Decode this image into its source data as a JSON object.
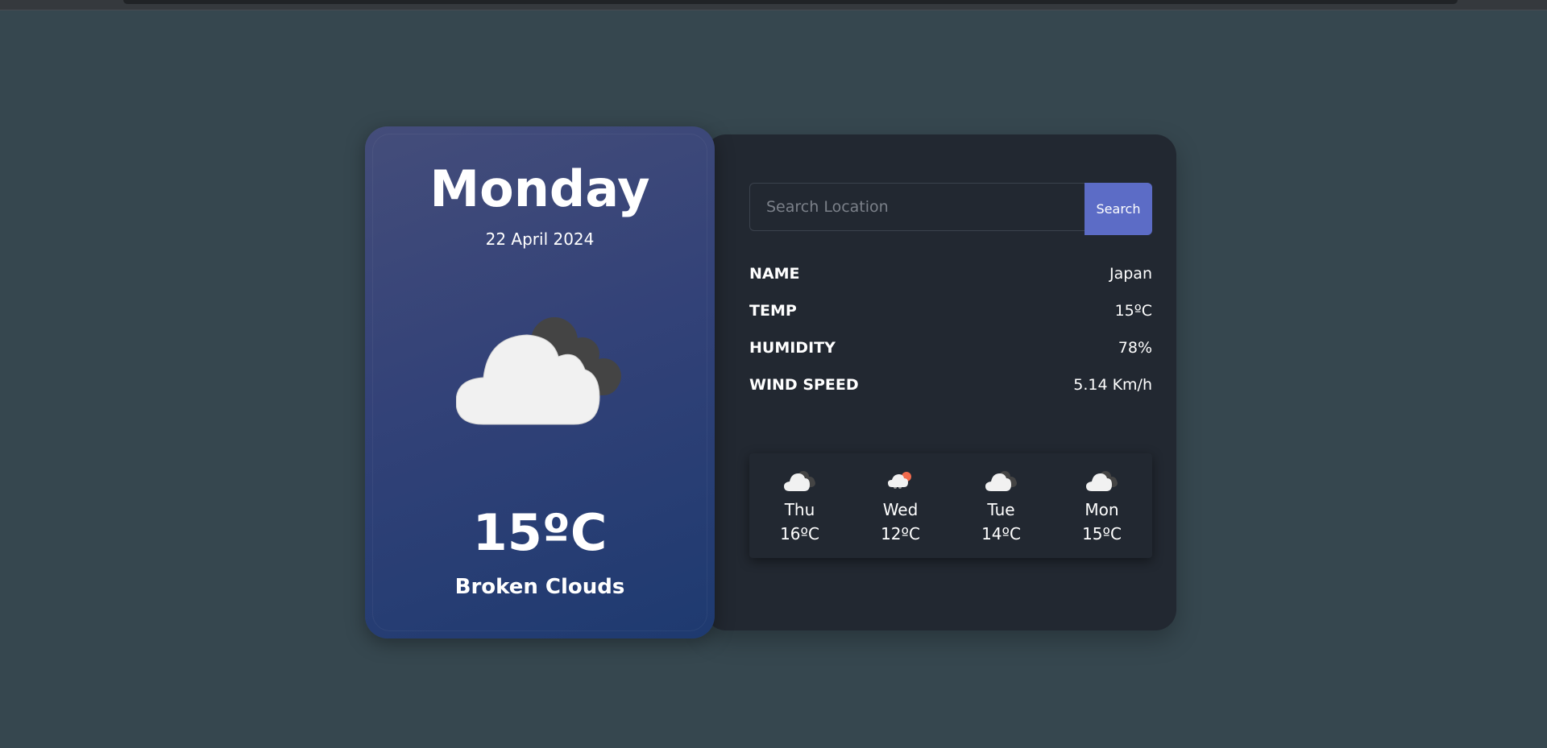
{
  "weather": {
    "day": "Monday",
    "date": "22 April 2024",
    "temperature": "15ºC",
    "description": "Broken Clouds",
    "icon": "broken-clouds-icon"
  },
  "search": {
    "placeholder": "Search Location",
    "value": "",
    "button_label": "Search"
  },
  "details": [
    {
      "label": "NAME",
      "value": "Japan"
    },
    {
      "label": "TEMP",
      "value": "15ºC"
    },
    {
      "label": "HUMIDITY",
      "value": "78%"
    },
    {
      "label": "WIND SPEED",
      "value": "5.14 Km/h"
    }
  ],
  "forecast": [
    {
      "day": "Thu",
      "temp": "16ºC",
      "icon": "broken-clouds-icon"
    },
    {
      "day": "Wed",
      "temp": "12ºC",
      "icon": "cloud-sun-icon"
    },
    {
      "day": "Tue",
      "temp": "14ºC",
      "icon": "broken-clouds-icon"
    },
    {
      "day": "Mon",
      "temp": "15ºC",
      "icon": "broken-clouds-icon"
    }
  ],
  "colors": {
    "page_background": "#36474f",
    "card_background": "#222831",
    "accent": "#5c6cc6",
    "panel_gradient_start": "#444d7a",
    "panel_gradient_end": "#1e3a70"
  }
}
